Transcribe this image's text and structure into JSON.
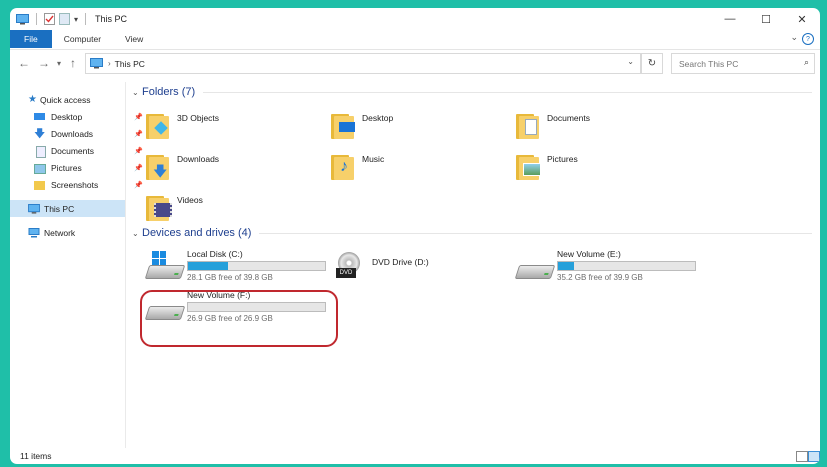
{
  "window": {
    "title": "This PC",
    "controls": {
      "minimize": "—",
      "maximize": "☐",
      "close": "✕"
    }
  },
  "ribbon": {
    "tabs": [
      {
        "label": "File",
        "active": true
      },
      {
        "label": "Computer",
        "active": false
      },
      {
        "label": "View",
        "active": false
      }
    ],
    "help": "?"
  },
  "address": {
    "crumb": "This PC",
    "search_placeholder": "Search This PC"
  },
  "navpane": {
    "quick_access": "Quick access",
    "quick_items": [
      {
        "label": "Desktop",
        "pinned": true,
        "icon": "desktop-icon"
      },
      {
        "label": "Downloads",
        "pinned": true,
        "icon": "download-arrow-icon"
      },
      {
        "label": "Documents",
        "pinned": true,
        "icon": "documents-icon"
      },
      {
        "label": "Pictures",
        "pinned": true,
        "icon": "pictures-icon"
      },
      {
        "label": "Screenshots",
        "pinned": true,
        "icon": "folder-icon"
      }
    ],
    "this_pc": "This PC",
    "network": "Network"
  },
  "folders": {
    "header": "Folders (7)",
    "items": [
      {
        "label": "3D Objects",
        "icon": "3d-objects-folder-icon"
      },
      {
        "label": "Desktop",
        "icon": "desktop-folder-icon"
      },
      {
        "label": "Documents",
        "icon": "documents-folder-icon"
      },
      {
        "label": "Downloads",
        "icon": "downloads-folder-icon"
      },
      {
        "label": "Music",
        "icon": "music-folder-icon"
      },
      {
        "label": "Pictures",
        "icon": "pictures-folder-icon"
      },
      {
        "label": "Videos",
        "icon": "videos-folder-icon"
      }
    ]
  },
  "drives": {
    "header": "Devices and drives (4)",
    "items": [
      {
        "label": "Local Disk (C:)",
        "free": "28.1 GB free of 39.8 GB",
        "used_fraction": 0.29,
        "icon": "windows-drive-icon",
        "has_bar": true
      },
      {
        "label": "DVD Drive (D:)",
        "free": "",
        "used_fraction": 0,
        "icon": "dvd-drive-icon",
        "has_bar": false
      },
      {
        "label": "New Volume (E:)",
        "free": "35.2 GB free of 39.9 GB",
        "used_fraction": 0.12,
        "icon": "hard-drive-icon",
        "has_bar": true
      },
      {
        "label": "New Volume (F:)",
        "free": "26.9 GB free of 26.9 GB",
        "used_fraction": 0.0,
        "icon": "hard-drive-icon",
        "has_bar": true,
        "highlighted": true
      }
    ]
  },
  "status": {
    "count": "11 items"
  },
  "colors": {
    "accent": "#1a6fc1",
    "bar_fill": "#26a0da",
    "highlight": "#c0282e",
    "frame": "#1fbfa8"
  }
}
